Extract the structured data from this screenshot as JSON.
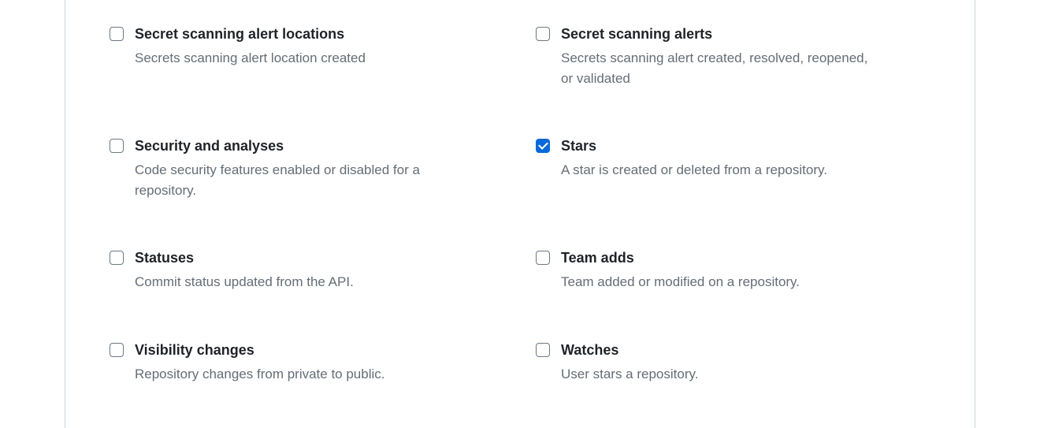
{
  "events": [
    {
      "id": "secret-scanning-alert-locations",
      "label": "Secret scanning alert locations",
      "description": "Secrets scanning alert location created",
      "checked": false
    },
    {
      "id": "secret-scanning-alerts",
      "label": "Secret scanning alerts",
      "description": "Secrets scanning alert created, resolved, reopened, or validated",
      "checked": false
    },
    {
      "id": "security-and-analyses",
      "label": "Security and analyses",
      "description": "Code security features enabled or disabled for a repository.",
      "checked": false
    },
    {
      "id": "stars",
      "label": "Stars",
      "description": "A star is created or deleted from a repository.",
      "checked": true
    },
    {
      "id": "statuses",
      "label": "Statuses",
      "description": "Commit status updated from the API.",
      "checked": false
    },
    {
      "id": "team-adds",
      "label": "Team adds",
      "description": "Team added or modified on a repository.",
      "checked": false
    },
    {
      "id": "visibility-changes",
      "label": "Visibility changes",
      "description": "Repository changes from private to public.",
      "checked": false
    },
    {
      "id": "watches",
      "label": "Watches",
      "description": "User stars a repository.",
      "checked": false
    }
  ]
}
